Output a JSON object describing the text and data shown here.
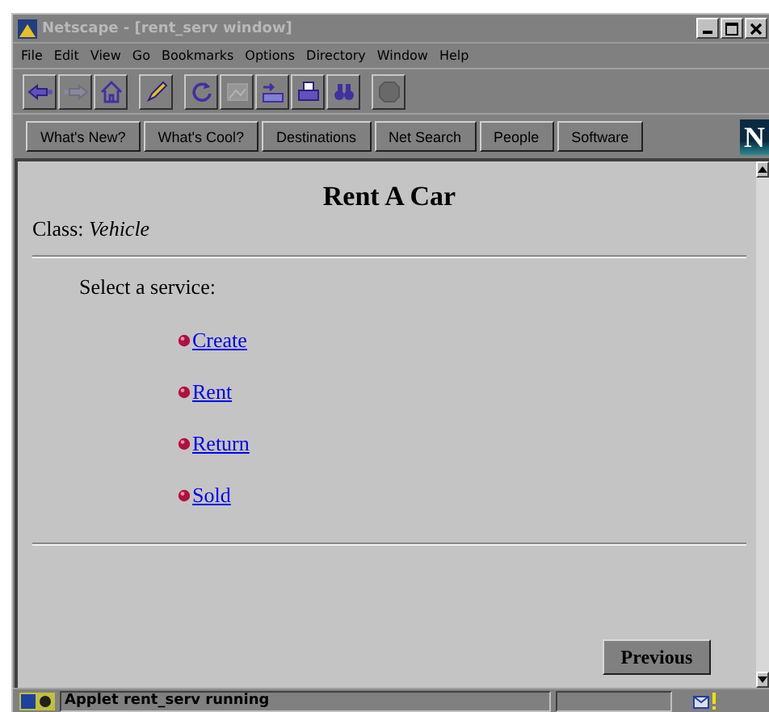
{
  "window": {
    "title": "Netscape - [rent_serv window]"
  },
  "menu": [
    "File",
    "Edit",
    "View",
    "Go",
    "Bookmarks",
    "Options",
    "Directory",
    "Window",
    "Help"
  ],
  "toolbar": [
    {
      "kind": "back",
      "disabled": false
    },
    {
      "kind": "forward",
      "disabled": true
    },
    {
      "kind": "home",
      "disabled": false
    },
    {
      "kind": "edit",
      "disabled": false
    },
    {
      "kind": "reload",
      "disabled": false
    },
    {
      "kind": "images",
      "disabled": true
    },
    {
      "kind": "open",
      "disabled": false
    },
    {
      "kind": "print",
      "disabled": false
    },
    {
      "kind": "find",
      "disabled": false
    },
    {
      "kind": "stop",
      "disabled": true
    }
  ],
  "directory_buttons": [
    "What's New?",
    "What's Cool?",
    "Destinations",
    "Net Search",
    "People",
    "Software"
  ],
  "logo": "N",
  "page": {
    "heading": "Rent A Car",
    "class_line": "Class: *Vehicle*",
    "prompt": "Select a service:",
    "links": [
      "Create",
      "Rent",
      "Return",
      "Sold"
    ],
    "button": "Previous"
  },
  "status_bar": {
    "message": "Applet rent_serv running"
  }
}
